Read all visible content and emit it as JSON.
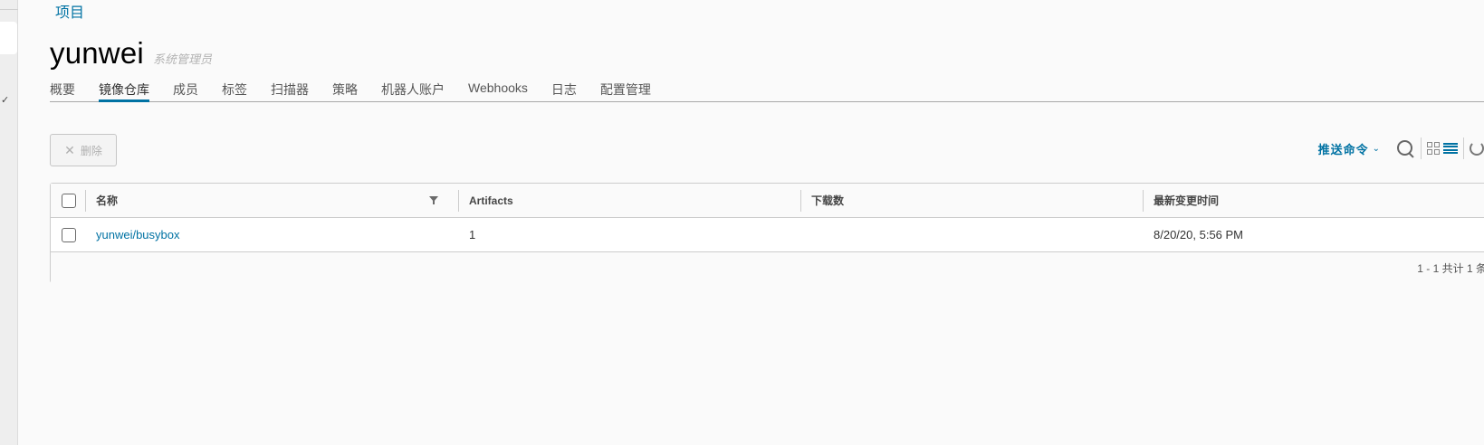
{
  "breadcrumb": {
    "projects": "项目"
  },
  "project": {
    "name": "yunwei",
    "role": "系统管理员"
  },
  "tabs": [
    {
      "label": "概要",
      "active": false
    },
    {
      "label": "镜像仓库",
      "active": true
    },
    {
      "label": "成员",
      "active": false
    },
    {
      "label": "标签",
      "active": false
    },
    {
      "label": "扫描器",
      "active": false
    },
    {
      "label": "策略",
      "active": false
    },
    {
      "label": "机器人账户",
      "active": false
    },
    {
      "label": "Webhooks",
      "active": false
    },
    {
      "label": "日志",
      "active": false
    },
    {
      "label": "配置管理",
      "active": false
    }
  ],
  "toolbar": {
    "delete_label": "删除",
    "push_command_label": "推送命令",
    "icons": [
      "close-icon",
      "chevron-down-icon",
      "search-icon",
      "card-view-icon",
      "list-view-icon",
      "refresh-icon"
    ]
  },
  "table": {
    "columns": [
      "名称",
      "Artifacts",
      "下载数",
      "最新变更时间"
    ],
    "rows": [
      {
        "name": "yunwei/busybox",
        "artifacts": "1",
        "downloads": "",
        "updated": "8/20/20, 5:56 PM"
      }
    ],
    "footer": "1 - 1 共计 1 条"
  },
  "colors": {
    "accent": "#0072a3",
    "text": "#333333",
    "muted": "#b3b3b3"
  }
}
